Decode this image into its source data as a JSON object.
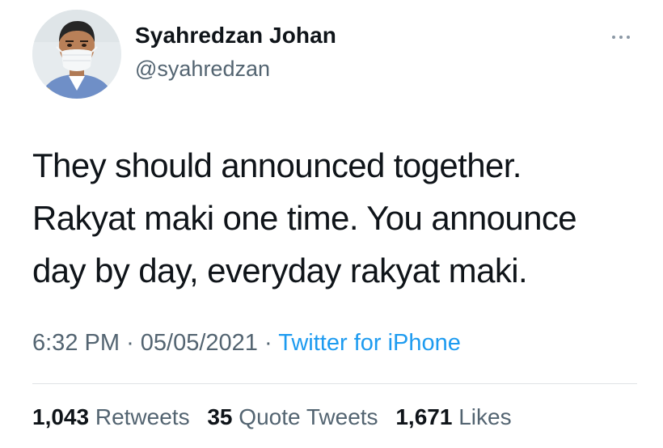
{
  "author": {
    "name": "Syahredzan Johan",
    "handle": "@syahredzan"
  },
  "tweet": {
    "lines": [
      "They should announced together.",
      "Rakyat maki one time. You announce",
      "day by day, everyday rakyat maki."
    ]
  },
  "meta": {
    "time": "6:32 PM",
    "separator": "·",
    "date": "05/05/2021",
    "source": "Twitter for iPhone"
  },
  "stats": {
    "retweets_count": "1,043",
    "retweets_label": "Retweets",
    "quote_count": "35",
    "quote_label": "Quote Tweets",
    "likes_count": "1,671",
    "likes_label": "Likes"
  },
  "icons": {
    "more": "more-horizontal-icon",
    "avatar": "profile-photo"
  },
  "colors": {
    "text": "#0f1419",
    "muted": "#536471",
    "link": "#1d9bf0",
    "divider": "#dfe3e6"
  }
}
